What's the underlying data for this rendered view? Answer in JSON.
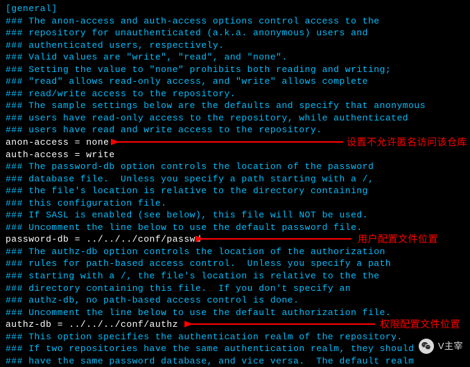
{
  "config": {
    "section_header": "[general]",
    "comments_block1": [
      "### The anon-access and auth-access options control access to the",
      "### repository for unauthenticated (a.k.a. anonymous) users and",
      "### authenticated users, respectively.",
      "### Valid values are \"write\", \"read\", and \"none\".",
      "### Setting the value to \"none\" prohibits both reading and writing;",
      "### \"read\" allows read-only access, and \"write\" allows complete",
      "### read/write access to the repository.",
      "### The sample settings below are the defaults and specify that anonymous",
      "### users have read-only access to the repository, while authenticated",
      "### users have read and write access to the repository."
    ],
    "setting_anon": "anon-access = none",
    "setting_auth": "auth-access = write",
    "comments_block2": [
      "### The password-db option controls the location of the password",
      "### database file.  Unless you specify a path starting with a /,",
      "### the file's location is relative to the directory containing",
      "### this configuration file.",
      "### If SASL is enabled (see below), this file will NOT be used.",
      "### Uncomment the line below to use the default password file."
    ],
    "setting_passwd": "password-db = ../../../conf/passwd",
    "comments_block3": [
      "### The authz-db option controls the location of the authorization",
      "### rules for path-based access control.  Unless you specify a path",
      "### starting with a /, the file's location is relative to the the",
      "### directory containing this file.  If you don't specify an",
      "### authz-db, no path-based access control is done.",
      "### Uncomment the line below to use the default authorization file."
    ],
    "setting_authz": "authz-db = ../../../conf/authz",
    "comments_block4": [
      "### This option specifies the authentication realm of the repository.",
      "### If two repositories have the same authentication realm, they should",
      "### have the same password database, and vice versa.  The default realm"
    ]
  },
  "annotations": {
    "anon_note": "设置不允许匿名访问该仓库",
    "passwd_note": "用户配置文件位置",
    "authz_note": "权限配置文件位置"
  },
  "watermark": {
    "text": "V主宰"
  }
}
